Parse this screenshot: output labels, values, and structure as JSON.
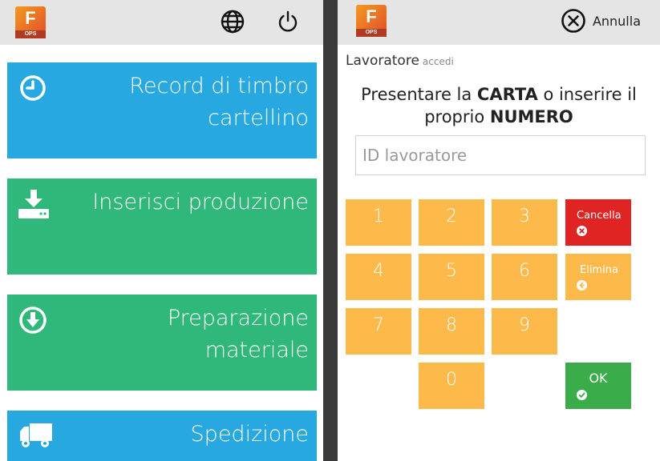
{
  "left": {
    "logo": {
      "letter": "F",
      "badge": "OPS"
    },
    "tiles": [
      {
        "label_line1": "Record di timbro",
        "label_line2": "cartellino",
        "icon": "clock-icon",
        "color": "#28a8e0"
      },
      {
        "label_line1": "Inserisci produzione",
        "label_line2": "",
        "icon": "download-tray-icon",
        "color": "#2fb879"
      },
      {
        "label_line1": "Preparazione",
        "label_line2": "materiale",
        "icon": "arrow-down-circle-icon",
        "color": "#2fb879"
      },
      {
        "label_line1": "Spedizione",
        "label_line2": "",
        "icon": "truck-icon",
        "color": "#28a8e0"
      }
    ]
  },
  "right": {
    "logo": {
      "letter": "F",
      "badge": "OPS"
    },
    "cancel_label": "Annulla",
    "worker_title": "Lavoratore",
    "worker_sub": "accedi",
    "prompt": {
      "pre": "Presentare la ",
      "card": "CARTA",
      "mid": " o inserire il",
      "pre2": "proprio ",
      "number": "NUMERO"
    },
    "input_placeholder": "ID lavoratore",
    "keys": [
      "1",
      "2",
      "3",
      "4",
      "5",
      "6",
      "7",
      "8",
      "9",
      "0"
    ],
    "clear_label": "Cancella",
    "delete_label": "Elimina",
    "ok_label": "OK"
  }
}
